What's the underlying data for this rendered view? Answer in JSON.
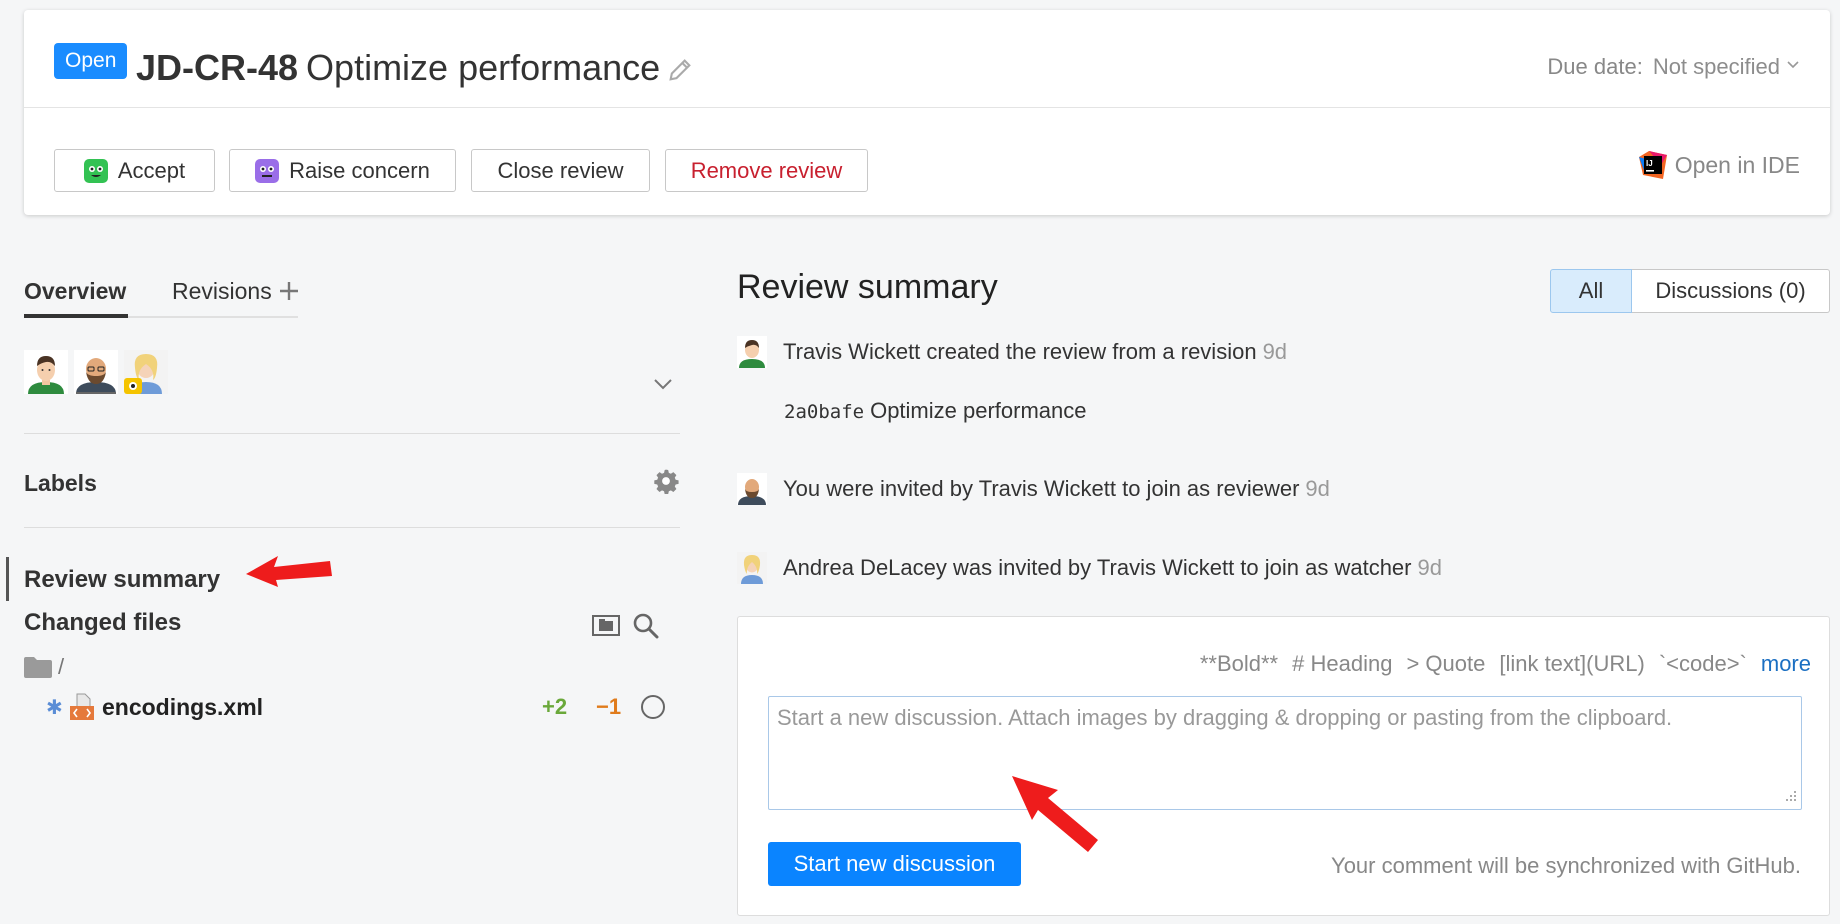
{
  "header": {
    "status": "Open",
    "review_id": "JD-CR-48",
    "review_title": "Optimize performance",
    "due_date_label": "Due date:",
    "due_date_value": "Not specified",
    "actions": {
      "accept": "Accept",
      "raise_concern": "Raise concern",
      "close_review": "Close review",
      "remove_review": "Remove review"
    },
    "open_in_ide": "Open in IDE"
  },
  "left": {
    "tabs": {
      "overview": "Overview",
      "revisions": "Revisions"
    },
    "labels_title": "Labels",
    "nav": {
      "review_summary": "Review summary",
      "changed_files": "Changed files"
    },
    "tree": {
      "folder": "/",
      "file": {
        "name": "encodings.xml",
        "added": "+2",
        "removed": "−1"
      }
    }
  },
  "main": {
    "title": "Review summary",
    "filters": {
      "all": "All",
      "discussions": "Discussions (0)"
    },
    "events": [
      {
        "text": "Travis Wickett created the review from a revision",
        "time": "9d"
      },
      {
        "text": "You were invited by Travis Wickett to join as reviewer",
        "time": "9d"
      },
      {
        "text": "Andrea DeLacey was invited by Travis Wickett to join as watcher",
        "time": "9d"
      }
    ],
    "commit": {
      "hash": "2a0bafe",
      "message": "Optimize performance"
    },
    "editor": {
      "toolbar": [
        "**Bold**",
        "# Heading",
        "> Quote",
        "[link text](URL)",
        "`<code>`"
      ],
      "more": "more",
      "placeholder": "Start a new discussion. Attach images by dragging & dropping or pasting from the clipboard.",
      "submit": "Start new discussion",
      "sync_note": "Your comment will be synchronized with GitHub."
    }
  },
  "colors": {
    "accent": "#1a8cff",
    "danger": "#c8202f",
    "added": "#6aa83a",
    "removed": "#e07b1b",
    "annotation_arrow": "#ee1c1c"
  }
}
